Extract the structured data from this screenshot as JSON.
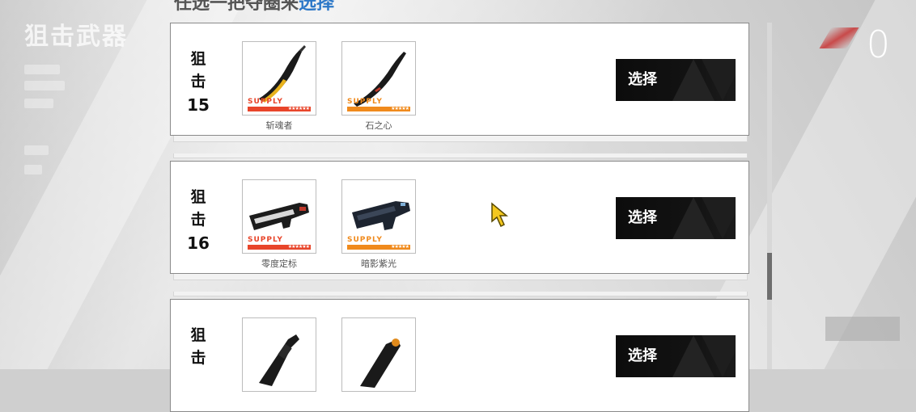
{
  "background": {
    "side_title": "狙击武器"
  },
  "header": {
    "prefix": "任选一把夺圈来",
    "highlight": "选择"
  },
  "hud": {
    "score": "0"
  },
  "cards": [
    {
      "category": "狙击",
      "number": "15",
      "items": [
        {
          "name": "斩魂者",
          "supply": "SUPPLY",
          "stars": "★★★★★★",
          "rarity_color": "#e8452a",
          "icon": "blade-icon"
        },
        {
          "name": "石之心",
          "supply": "SUPPLY",
          "stars": "★★★★★",
          "rarity_color": "#f08a1c",
          "icon": "blade-icon"
        }
      ],
      "button": "选择"
    },
    {
      "category": "狙击",
      "number": "16",
      "items": [
        {
          "name": "零度定标",
          "supply": "SUPPLY",
          "stars": "★★★★★★",
          "rarity_color": "#e8452a",
          "icon": "rifle-icon"
        },
        {
          "name": "暗影紫光",
          "supply": "SUPPLY",
          "stars": "★★★★★",
          "rarity_color": "#f08a1c",
          "icon": "rifle-icon"
        }
      ],
      "button": "选择"
    },
    {
      "category": "狙击",
      "number": "",
      "items": [
        {
          "name": "",
          "icon": "scope-rifle-icon"
        },
        {
          "name": "",
          "icon": "scope-rifle-icon"
        }
      ],
      "button": "选择"
    }
  ],
  "colors": {
    "accent": "#2d78c8",
    "button_bg": "#111111",
    "supply_red": "#e8452a",
    "supply_orange": "#f08a1c"
  }
}
